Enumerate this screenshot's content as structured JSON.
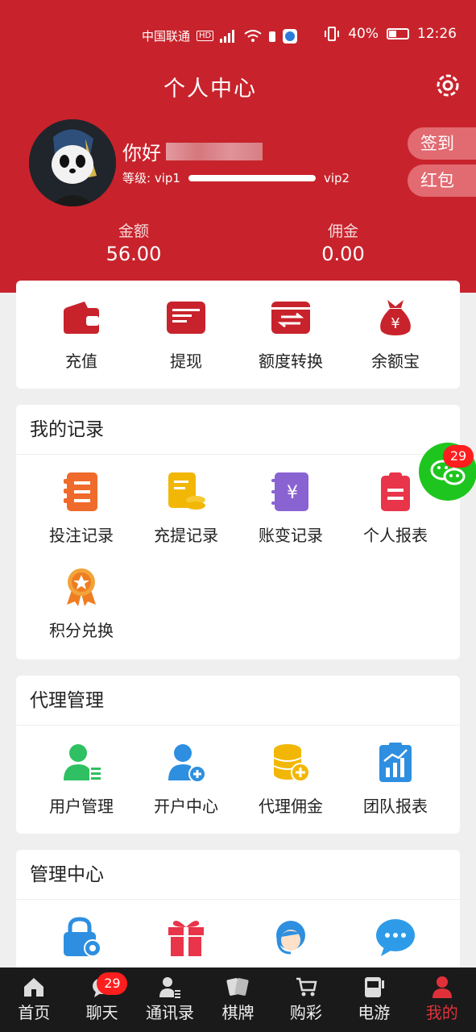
{
  "status": {
    "carrier": "中国联通",
    "hd": "HD",
    "battery": "40%",
    "time": "12:26"
  },
  "header": {
    "title": "个人中心"
  },
  "profile": {
    "greeting": "你好",
    "level_label": "等级: vip1",
    "next_level": "vip2",
    "level_progress_percent": 100,
    "sign_in_label": "签到",
    "red_packet_label": "红包"
  },
  "wallet": {
    "balance_label": "金额",
    "balance": "56.00",
    "commission_label": "佣金",
    "commission": "0.00"
  },
  "quick_actions": [
    {
      "label": "充值",
      "icon": "wallet-icon"
    },
    {
      "label": "提现",
      "icon": "card-icon"
    },
    {
      "label": "额度转换",
      "icon": "transfer-icon"
    },
    {
      "label": "余额宝",
      "icon": "money-bag-icon"
    }
  ],
  "records": {
    "title": "我的记录",
    "items": [
      {
        "label": "投注记录",
        "icon": "list-icon"
      },
      {
        "label": "充提记录",
        "icon": "coins-clipboard-icon"
      },
      {
        "label": "账变记录",
        "icon": "yuan-book-icon"
      },
      {
        "label": "个人报表",
        "icon": "report-icon"
      },
      {
        "label": "积分兑换",
        "icon": "medal-icon"
      }
    ]
  },
  "agent": {
    "title": "代理管理",
    "items": [
      {
        "label": "用户管理",
        "icon": "user-list-icon"
      },
      {
        "label": "开户中心",
        "icon": "add-user-icon"
      },
      {
        "label": "代理佣金",
        "icon": "coins-plus-icon"
      },
      {
        "label": "团队报表",
        "icon": "chart-clipboard-icon"
      }
    ]
  },
  "management": {
    "title": "管理中心",
    "items": [
      {
        "icon": "lock-gear-icon"
      },
      {
        "icon": "gift-icon"
      },
      {
        "icon": "customer-service-icon"
      },
      {
        "icon": "chat-bubble-icon"
      }
    ]
  },
  "float_chat": {
    "badge": "29"
  },
  "tabs": [
    {
      "label": "首页",
      "icon": "home-icon"
    },
    {
      "label": "聊天",
      "icon": "chat-icon",
      "badge": "29"
    },
    {
      "label": "通讯录",
      "icon": "contacts-icon"
    },
    {
      "label": "棋牌",
      "icon": "cards-icon"
    },
    {
      "label": "购彩",
      "icon": "lottery-cart-icon"
    },
    {
      "label": "电游",
      "icon": "slot-machine-icon"
    },
    {
      "label": "我的",
      "icon": "user-icon",
      "active": true
    }
  ],
  "colors": {
    "brand_red": "#c8232c",
    "badge_red": "#ff1e1e",
    "float_green": "#1ec51e"
  }
}
